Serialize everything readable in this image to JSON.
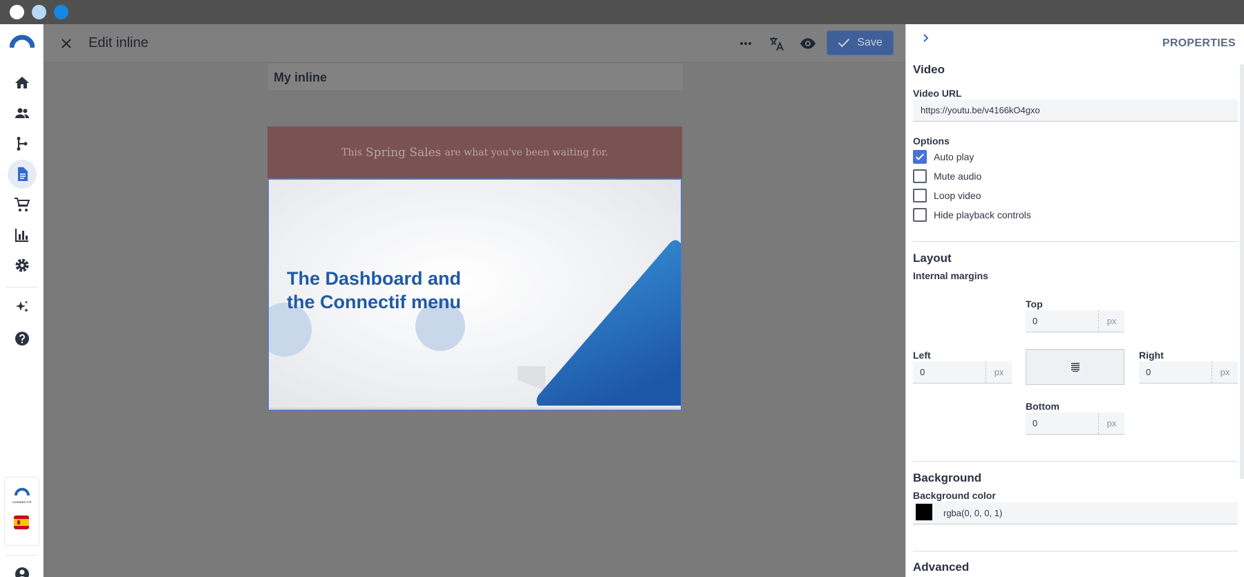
{
  "window": {
    "traffic_lights": [
      "#ffffff",
      "#b8d8f5",
      "#1487e0"
    ]
  },
  "sidebar": {
    "items": [
      {
        "name": "home-icon",
        "active": false
      },
      {
        "name": "contacts-icon",
        "active": false
      },
      {
        "name": "workflows-icon",
        "active": false
      },
      {
        "name": "content-icon",
        "active": true
      },
      {
        "name": "cart-icon",
        "active": false
      },
      {
        "name": "reports-icon",
        "active": false
      },
      {
        "name": "settings-icon",
        "active": false
      },
      {
        "name": "ai-sparkle-icon",
        "active": false
      },
      {
        "name": "help-icon",
        "active": false
      }
    ],
    "brand_text": "CONNECTIF",
    "account_icon": "account-icon",
    "accent_color": "#2e5aa8"
  },
  "header": {
    "title": "Edit inline",
    "save_label": "Save"
  },
  "canvas": {
    "inline_name": "My inline",
    "banner": {
      "prefix": "This",
      "highlight": "Spring Sales",
      "suffix": "are what you've been waiting for."
    },
    "video_title_line1": "The Dashboard and",
    "video_title_line2": "the Connectif menu"
  },
  "panel": {
    "title": "PROPERTIES",
    "video_section": "Video",
    "video_url_label": "Video URL",
    "video_url_value": "https://youtu.be/v4166kO4gxo",
    "options_label": "Options",
    "options": [
      {
        "label": "Auto play",
        "checked": true
      },
      {
        "label": "Mute audio",
        "checked": false
      },
      {
        "label": "Loop video",
        "checked": false
      },
      {
        "label": "Hide playback controls",
        "checked": false
      }
    ],
    "layout_section": "Layout",
    "internal_margins_label": "Internal margins",
    "margins": {
      "top_label": "Top",
      "top_value": "0",
      "left_label": "Left",
      "left_value": "0",
      "right_label": "Right",
      "right_value": "0",
      "bottom_label": "Bottom",
      "bottom_value": "0",
      "unit": "px"
    },
    "background_section": "Background",
    "background_color_label": "Background color",
    "background_color_value": "rgba(0, 0, 0, 1)",
    "advanced_section": "Advanced"
  }
}
